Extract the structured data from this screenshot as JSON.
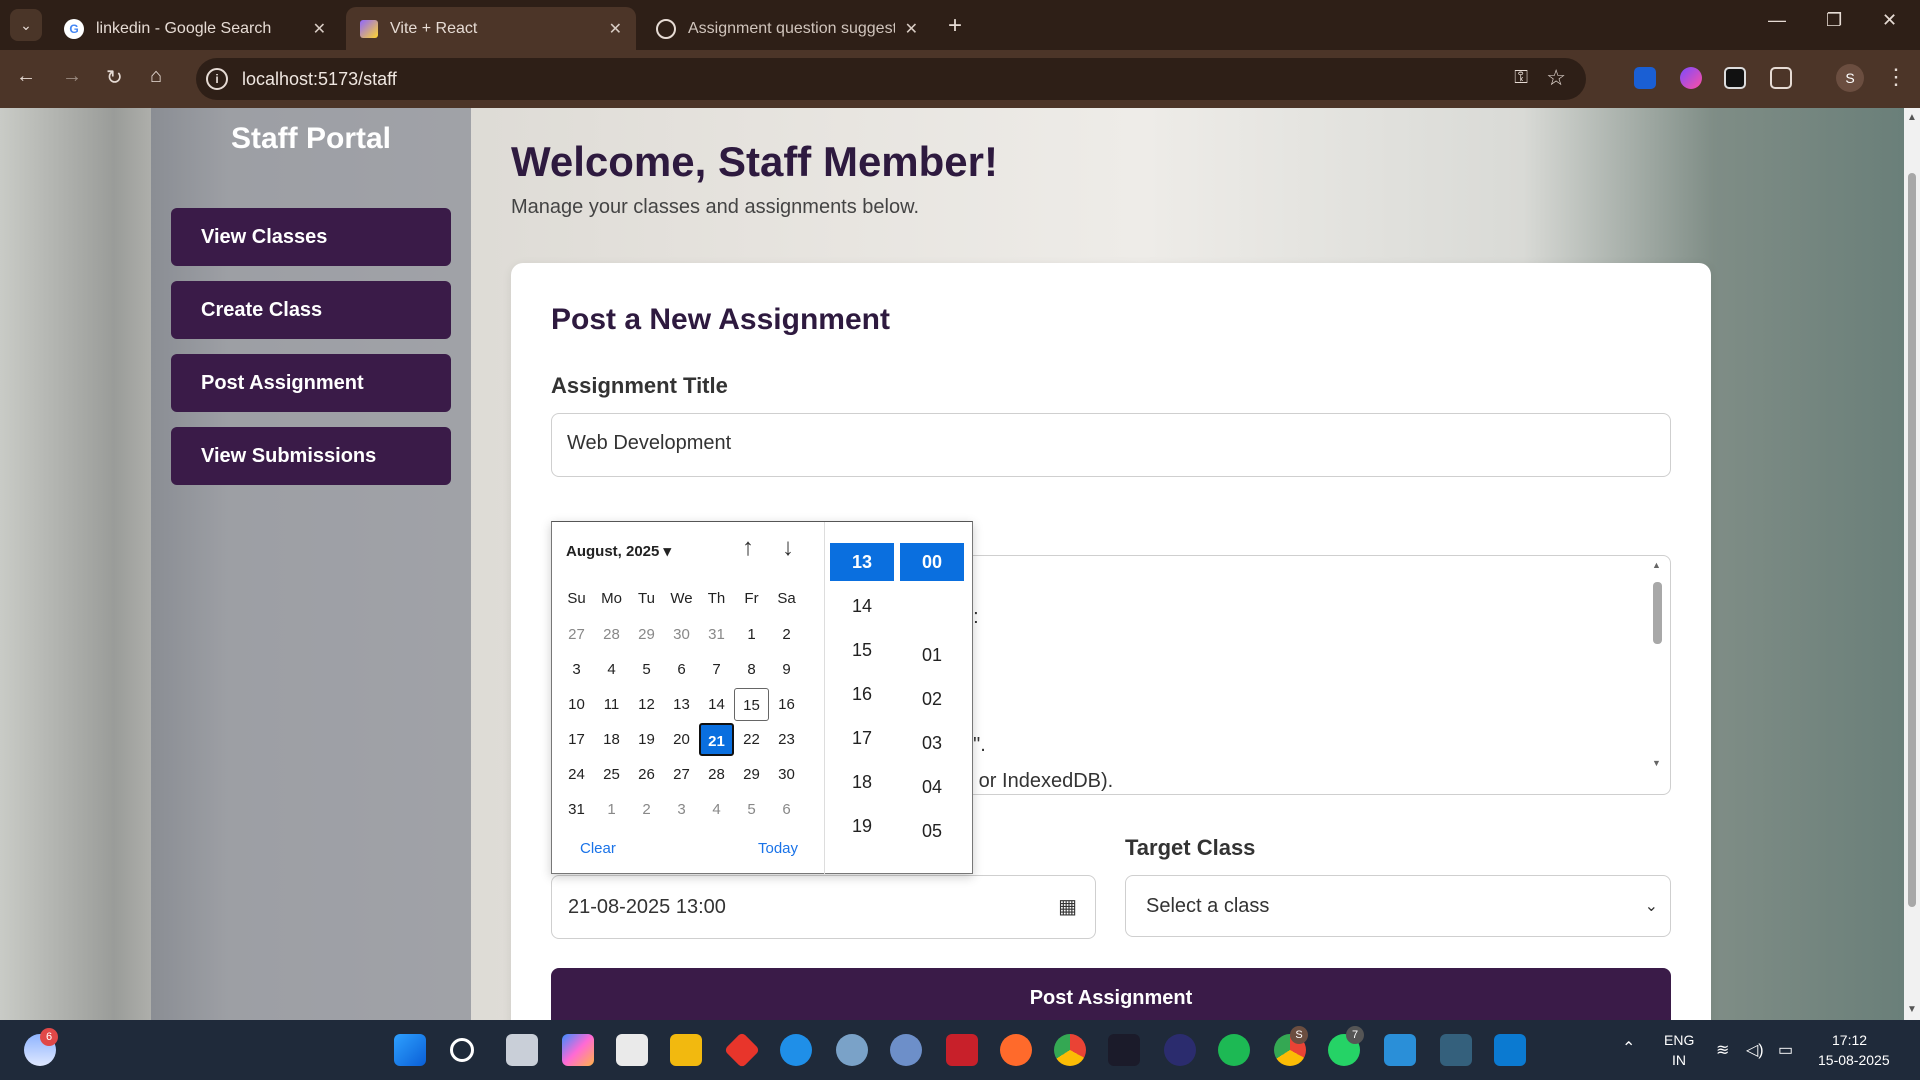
{
  "browser": {
    "tabs": [
      {
        "title": "linkedin - Google Search",
        "active": false
      },
      {
        "title": "Vite + React",
        "active": true
      },
      {
        "title": "Assignment question suggestio",
        "active": false
      }
    ],
    "url": "localhost:5173/staff",
    "profile_initial": "S"
  },
  "sidebar": {
    "title": "Staff Portal",
    "items": [
      {
        "label": "View Classes"
      },
      {
        "label": "Create Class"
      },
      {
        "label": "Post Assignment"
      },
      {
        "label": "View Submissions"
      }
    ]
  },
  "main": {
    "welcome": "Welcome, Staff Member!",
    "subtitle": "Manage your classes and assignments below.",
    "form": {
      "heading": "Post a New Assignment",
      "title_label": "Assignment Title",
      "title_value": "Web Development",
      "description_visible_fragments": [
        "n:",
        "g\".",
        "e or IndexedDB)."
      ],
      "deadline_value": "21-08-2025 13:00",
      "target_class_label": "Target Class",
      "target_class_value": "Select a class",
      "submit_label": "Post Assignment"
    }
  },
  "datepicker": {
    "month_label": "August, 2025",
    "weekdays": [
      "Su",
      "Mo",
      "Tu",
      "We",
      "Th",
      "Fr",
      "Sa"
    ],
    "weeks": [
      [
        "27",
        "28",
        "29",
        "30",
        "31",
        "1",
        "2"
      ],
      [
        "3",
        "4",
        "5",
        "6",
        "7",
        "8",
        "9"
      ],
      [
        "10",
        "11",
        "12",
        "13",
        "14",
        "15",
        "16"
      ],
      [
        "17",
        "18",
        "19",
        "20",
        "21",
        "22",
        "23"
      ],
      [
        "24",
        "25",
        "26",
        "27",
        "28",
        "29",
        "30"
      ],
      [
        "31",
        "1",
        "2",
        "3",
        "4",
        "5",
        "6"
      ]
    ],
    "today": "15",
    "selected": "21",
    "clear_label": "Clear",
    "today_label": "Today",
    "hours": [
      "13",
      "14",
      "15",
      "16",
      "17",
      "18",
      "19"
    ],
    "minutes": [
      "00",
      "01",
      "02",
      "03",
      "04",
      "05"
    ],
    "selected_hour": "13",
    "selected_minute": "00"
  },
  "taskbar": {
    "weather_badge": "6",
    "chrome_badge": "S",
    "whatsapp_badge": "7",
    "lang_top": "ENG",
    "lang_bottom": "IN",
    "time": "17:12",
    "date": "15-08-2025"
  }
}
